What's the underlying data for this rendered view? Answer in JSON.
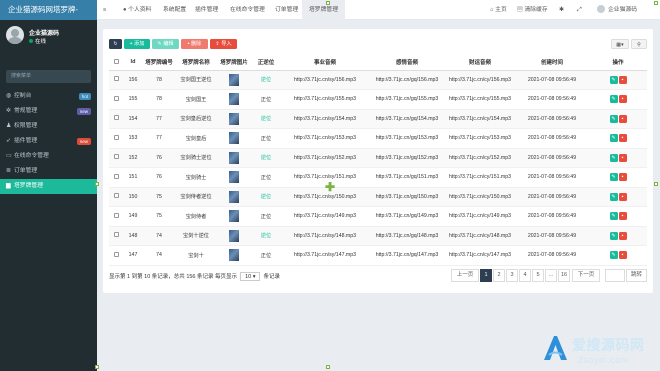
{
  "brand": "企业猫源码网塔罗牌-",
  "user": {
    "name": "企业猫源码",
    "status": "在线"
  },
  "search_placeholder": "搜索菜单",
  "sidebar": {
    "items": [
      {
        "label": "控制台",
        "icon": "dashboard-icon",
        "badge": "hot",
        "badge_color": "#3c8dbc"
      },
      {
        "label": "常规管理",
        "icon": "cogs-icon",
        "badge": "new",
        "badge_color": "#605ca8"
      },
      {
        "label": "权限管理",
        "icon": "group-icon",
        "badge": "",
        "badge_color": ""
      },
      {
        "label": "插件管理",
        "icon": "rocket-icon",
        "badge": "new",
        "badge_color": "#dd4b39"
      },
      {
        "label": "在线命令管理",
        "icon": "terminal-icon",
        "badge": "",
        "badge_color": ""
      },
      {
        "label": "订单管理",
        "icon": "list-icon",
        "badge": "",
        "badge_color": ""
      },
      {
        "label": "塔罗牌管理",
        "icon": "file-icon",
        "badge": "",
        "badge_color": ""
      }
    ]
  },
  "topnav": {
    "menu_toggle": "≡",
    "tabs": [
      "个人资料",
      "系统配置",
      "插件管理",
      "在线命令管理",
      "订单管理",
      "塔罗牌管理"
    ],
    "home": "主页",
    "clear_cache": "清除缓存",
    "admin_name": "企业猫源码"
  },
  "toolbar": {
    "add": "添加",
    "edit": "编辑",
    "delete": "删除",
    "import": "导入"
  },
  "table": {
    "headers": [
      "Id",
      "塔罗牌编号",
      "塔罗牌名称",
      "塔罗牌图片",
      "正逆位",
      "事业音频",
      "感情音频",
      "财运音频",
      "创建时间",
      "操作"
    ],
    "rows": [
      {
        "id": "156",
        "no": "78",
        "name": "宝剑国王逆位",
        "pos": "逆位",
        "career": "http://3.71jc.cn/sy/156.mp3",
        "love": "http://3.71jc.cn/gq/156.mp3",
        "wealth": "http://3.71jc.cn/cy/156.mp3",
        "time": "2021-07-08 09:56:49"
      },
      {
        "id": "155",
        "no": "78",
        "name": "宝剑国王",
        "pos": "正位",
        "career": "http://3.71jc.cn/sy/155.mp3",
        "love": "http://3.71jc.cn/gq/155.mp3",
        "wealth": "http://3.71jc.cn/cy/155.mp3",
        "time": "2021-07-08 09:56:49"
      },
      {
        "id": "154",
        "no": "77",
        "name": "宝剑皇后逆位",
        "pos": "逆位",
        "career": "http://3.71jc.cn/sy/154.mp3",
        "love": "http://3.71jc.cn/gq/154.mp3",
        "wealth": "http://3.71jc.cn/cy/154.mp3",
        "time": "2021-07-08 09:56:49"
      },
      {
        "id": "153",
        "no": "77",
        "name": "宝剑皇后",
        "pos": "正位",
        "career": "http://3.71jc.cn/sy/153.mp3",
        "love": "http://3.71jc.cn/gq/153.mp3",
        "wealth": "http://3.71jc.cn/cy/153.mp3",
        "time": "2021-07-08 09:56:49"
      },
      {
        "id": "152",
        "no": "76",
        "name": "宝剑骑士逆位",
        "pos": "逆位",
        "career": "http://3.71jc.cn/sy/152.mp3",
        "love": "http://3.71jc.cn/gq/152.mp3",
        "wealth": "http://3.71jc.cn/cy/152.mp3",
        "time": "2021-07-08 09:56:49"
      },
      {
        "id": "151",
        "no": "76",
        "name": "宝剑骑士",
        "pos": "正位",
        "career": "http://3.71jc.cn/sy/151.mp3",
        "love": "http://3.71jc.cn/gq/151.mp3",
        "wealth": "http://3.71jc.cn/cy/151.mp3",
        "time": "2021-07-08 09:56:49"
      },
      {
        "id": "150",
        "no": "75",
        "name": "宝剑侍者逆位",
        "pos": "逆位",
        "career": "http://3.71jc.cn/sy/150.mp3",
        "love": "http://3.71jc.cn/gq/150.mp3",
        "wealth": "http://3.71jc.cn/cy/150.mp3",
        "time": "2021-07-08 09:56:49"
      },
      {
        "id": "149",
        "no": "75",
        "name": "宝剑侍者",
        "pos": "正位",
        "career": "http://3.71jc.cn/sy/149.mp3",
        "love": "http://3.71jc.cn/gq/149.mp3",
        "wealth": "http://3.71jc.cn/cy/149.mp3",
        "time": "2021-07-08 09:56:49"
      },
      {
        "id": "148",
        "no": "74",
        "name": "宝剑十逆位",
        "pos": "逆位",
        "career": "http://3.71jc.cn/sy/148.mp3",
        "love": "http://3.71jc.cn/gq/148.mp3",
        "wealth": "http://3.71jc.cn/cy/148.mp3",
        "time": "2021-07-08 09:56:49"
      },
      {
        "id": "147",
        "no": "74",
        "name": "宝剑十",
        "pos": "正位",
        "career": "http://3.71jc.cn/sy/147.mp3",
        "love": "http://3.71jc.cn/gq/147.mp3",
        "wealth": "http://3.71jc.cn/cy/147.mp3",
        "time": "2021-07-08 09:56:49"
      }
    ]
  },
  "footer": {
    "summary_prefix": "显示第 1 到第 10 条记录，总共 156 条记录 每页显示",
    "page_size": "10",
    "summary_suffix": "条记录",
    "prev": "上一页",
    "next": "下一页",
    "pages": [
      "1",
      "2",
      "3",
      "4",
      "5",
      "...",
      "16"
    ],
    "jump": "跳转"
  },
  "watermark": {
    "title": "爱搜源码网",
    "sub": "2soym.com"
  },
  "colors": {
    "sidebar": "#222d32",
    "brand": "#367fa9",
    "accent": "#18bc9c",
    "danger": "#e74c3c",
    "dark": "#2c3e50"
  }
}
